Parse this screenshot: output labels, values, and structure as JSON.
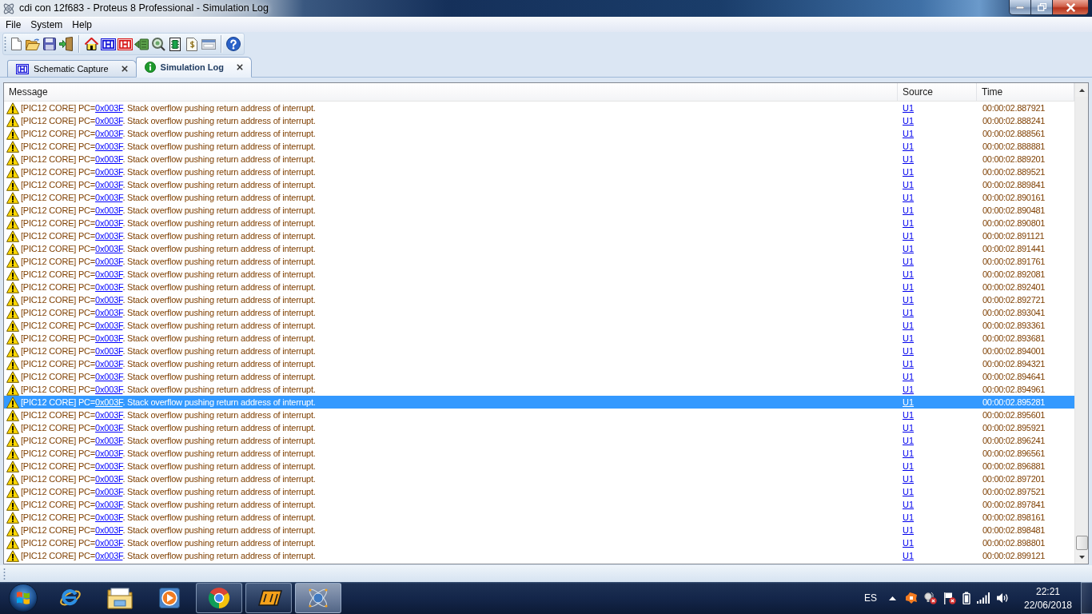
{
  "window": {
    "title": "cdi con 12f683 - Proteus 8 Professional - Simulation Log"
  },
  "menu": [
    "File",
    "System",
    "Help"
  ],
  "tabs": [
    {
      "label": "Schematic Capture",
      "selected": false
    },
    {
      "label": "Simulation Log",
      "selected": true
    }
  ],
  "table": {
    "columns": [
      "Message",
      "Source",
      "Time"
    ],
    "rows": [
      {
        "message_start": "[PIC12 CORE] PC=",
        "pc_link": "0x003F",
        "message_end": ". Stack overflow pushing return address of interrupt.",
        "source": "U1",
        "time": "00:00:02.887921",
        "selected": false
      },
      {
        "message_start": "[PIC12 CORE] PC=",
        "pc_link": "0x003F",
        "message_end": ". Stack overflow pushing return address of interrupt.",
        "source": "U1",
        "time": "00:00:02.888241",
        "selected": false
      },
      {
        "message_start": "[PIC12 CORE] PC=",
        "pc_link": "0x003F",
        "message_end": ". Stack overflow pushing return address of interrupt.",
        "source": "U1",
        "time": "00:00:02.888561",
        "selected": false
      },
      {
        "message_start": "[PIC12 CORE] PC=",
        "pc_link": "0x003F",
        "message_end": ". Stack overflow pushing return address of interrupt.",
        "source": "U1",
        "time": "00:00:02.888881",
        "selected": false
      },
      {
        "message_start": "[PIC12 CORE] PC=",
        "pc_link": "0x003F",
        "message_end": ". Stack overflow pushing return address of interrupt.",
        "source": "U1",
        "time": "00:00:02.889201",
        "selected": false
      },
      {
        "message_start": "[PIC12 CORE] PC=",
        "pc_link": "0x003F",
        "message_end": ". Stack overflow pushing return address of interrupt.",
        "source": "U1",
        "time": "00:00:02.889521",
        "selected": false
      },
      {
        "message_start": "[PIC12 CORE] PC=",
        "pc_link": "0x003F",
        "message_end": ". Stack overflow pushing return address of interrupt.",
        "source": "U1",
        "time": "00:00:02.889841",
        "selected": false
      },
      {
        "message_start": "[PIC12 CORE] PC=",
        "pc_link": "0x003F",
        "message_end": ". Stack overflow pushing return address of interrupt.",
        "source": "U1",
        "time": "00:00:02.890161",
        "selected": false
      },
      {
        "message_start": "[PIC12 CORE] PC=",
        "pc_link": "0x003F",
        "message_end": ". Stack overflow pushing return address of interrupt.",
        "source": "U1",
        "time": "00:00:02.890481",
        "selected": false
      },
      {
        "message_start": "[PIC12 CORE] PC=",
        "pc_link": "0x003F",
        "message_end": ". Stack overflow pushing return address of interrupt.",
        "source": "U1",
        "time": "00:00:02.890801",
        "selected": false
      },
      {
        "message_start": "[PIC12 CORE] PC=",
        "pc_link": "0x003F",
        "message_end": ". Stack overflow pushing return address of interrupt.",
        "source": "U1",
        "time": "00:00:02.891121",
        "selected": false
      },
      {
        "message_start": "[PIC12 CORE] PC=",
        "pc_link": "0x003F",
        "message_end": ". Stack overflow pushing return address of interrupt.",
        "source": "U1",
        "time": "00:00:02.891441",
        "selected": false
      },
      {
        "message_start": "[PIC12 CORE] PC=",
        "pc_link": "0x003F",
        "message_end": ". Stack overflow pushing return address of interrupt.",
        "source": "U1",
        "time": "00:00:02.891761",
        "selected": false
      },
      {
        "message_start": "[PIC12 CORE] PC=",
        "pc_link": "0x003F",
        "message_end": ". Stack overflow pushing return address of interrupt.",
        "source": "U1",
        "time": "00:00:02.892081",
        "selected": false
      },
      {
        "message_start": "[PIC12 CORE] PC=",
        "pc_link": "0x003F",
        "message_end": ". Stack overflow pushing return address of interrupt.",
        "source": "U1",
        "time": "00:00:02.892401",
        "selected": false
      },
      {
        "message_start": "[PIC12 CORE] PC=",
        "pc_link": "0x003F",
        "message_end": ". Stack overflow pushing return address of interrupt.",
        "source": "U1",
        "time": "00:00:02.892721",
        "selected": false
      },
      {
        "message_start": "[PIC12 CORE] PC=",
        "pc_link": "0x003F",
        "message_end": ". Stack overflow pushing return address of interrupt.",
        "source": "U1",
        "time": "00:00:02.893041",
        "selected": false
      },
      {
        "message_start": "[PIC12 CORE] PC=",
        "pc_link": "0x003F",
        "message_end": ". Stack overflow pushing return address of interrupt.",
        "source": "U1",
        "time": "00:00:02.893361",
        "selected": false
      },
      {
        "message_start": "[PIC12 CORE] PC=",
        "pc_link": "0x003F",
        "message_end": ". Stack overflow pushing return address of interrupt.",
        "source": "U1",
        "time": "00:00:02.893681",
        "selected": false
      },
      {
        "message_start": "[PIC12 CORE] PC=",
        "pc_link": "0x003F",
        "message_end": ". Stack overflow pushing return address of interrupt.",
        "source": "U1",
        "time": "00:00:02.894001",
        "selected": false
      },
      {
        "message_start": "[PIC12 CORE] PC=",
        "pc_link": "0x003F",
        "message_end": ". Stack overflow pushing return address of interrupt.",
        "source": "U1",
        "time": "00:00:02.894321",
        "selected": false
      },
      {
        "message_start": "[PIC12 CORE] PC=",
        "pc_link": "0x003F",
        "message_end": ". Stack overflow pushing return address of interrupt.",
        "source": "U1",
        "time": "00:00:02.894641",
        "selected": false
      },
      {
        "message_start": "[PIC12 CORE] PC=",
        "pc_link": "0x003F",
        "message_end": ". Stack overflow pushing return address of interrupt.",
        "source": "U1",
        "time": "00:00:02.894961",
        "selected": false
      },
      {
        "message_start": "[PIC12 CORE] PC=",
        "pc_link": "0x003F",
        "message_end": ". Stack overflow pushing return address of interrupt.",
        "source": "U1",
        "time": "00:00:02.895281",
        "selected": true
      },
      {
        "message_start": "[PIC12 CORE] PC=",
        "pc_link": "0x003F",
        "message_end": ". Stack overflow pushing return address of interrupt.",
        "source": "U1",
        "time": "00:00:02.895601",
        "selected": false
      },
      {
        "message_start": "[PIC12 CORE] PC=",
        "pc_link": "0x003F",
        "message_end": ". Stack overflow pushing return address of interrupt.",
        "source": "U1",
        "time": "00:00:02.895921",
        "selected": false
      },
      {
        "message_start": "[PIC12 CORE] PC=",
        "pc_link": "0x003F",
        "message_end": ". Stack overflow pushing return address of interrupt.",
        "source": "U1",
        "time": "00:00:02.896241",
        "selected": false
      },
      {
        "message_start": "[PIC12 CORE] PC=",
        "pc_link": "0x003F",
        "message_end": ". Stack overflow pushing return address of interrupt.",
        "source": "U1",
        "time": "00:00:02.896561",
        "selected": false
      },
      {
        "message_start": "[PIC12 CORE] PC=",
        "pc_link": "0x003F",
        "message_end": ". Stack overflow pushing return address of interrupt.",
        "source": "U1",
        "time": "00:00:02.896881",
        "selected": false
      },
      {
        "message_start": "[PIC12 CORE] PC=",
        "pc_link": "0x003F",
        "message_end": ". Stack overflow pushing return address of interrupt.",
        "source": "U1",
        "time": "00:00:02.897201",
        "selected": false
      },
      {
        "message_start": "[PIC12 CORE] PC=",
        "pc_link": "0x003F",
        "message_end": ". Stack overflow pushing return address of interrupt.",
        "source": "U1",
        "time": "00:00:02.897521",
        "selected": false
      },
      {
        "message_start": "[PIC12 CORE] PC=",
        "pc_link": "0x003F",
        "message_end": ". Stack overflow pushing return address of interrupt.",
        "source": "U1",
        "time": "00:00:02.897841",
        "selected": false
      },
      {
        "message_start": "[PIC12 CORE] PC=",
        "pc_link": "0x003F",
        "message_end": ". Stack overflow pushing return address of interrupt.",
        "source": "U1",
        "time": "00:00:02.898161",
        "selected": false
      },
      {
        "message_start": "[PIC12 CORE] PC=",
        "pc_link": "0x003F",
        "message_end": ". Stack overflow pushing return address of interrupt.",
        "source": "U1",
        "time": "00:00:02.898481",
        "selected": false
      },
      {
        "message_start": "[PIC12 CORE] PC=",
        "pc_link": "0x003F",
        "message_end": ". Stack overflow pushing return address of interrupt.",
        "source": "U1",
        "time": "00:00:02.898801",
        "selected": false
      },
      {
        "message_start": "[PIC12 CORE] PC=",
        "pc_link": "0x003F",
        "message_end": ". Stack overflow pushing return address of interrupt.",
        "source": "U1",
        "time": "00:00:02.899121",
        "selected": false
      }
    ]
  },
  "taskbar": {
    "apps": [
      {
        "running": false,
        "selected": false
      },
      {
        "running": false,
        "selected": false
      },
      {
        "running": false,
        "selected": false
      },
      {
        "running": true,
        "selected": false
      },
      {
        "running": true,
        "selected": false
      },
      {
        "running": true,
        "selected": true
      }
    ],
    "language": "ES",
    "time": "22:21",
    "date": "22/06/2018"
  }
}
